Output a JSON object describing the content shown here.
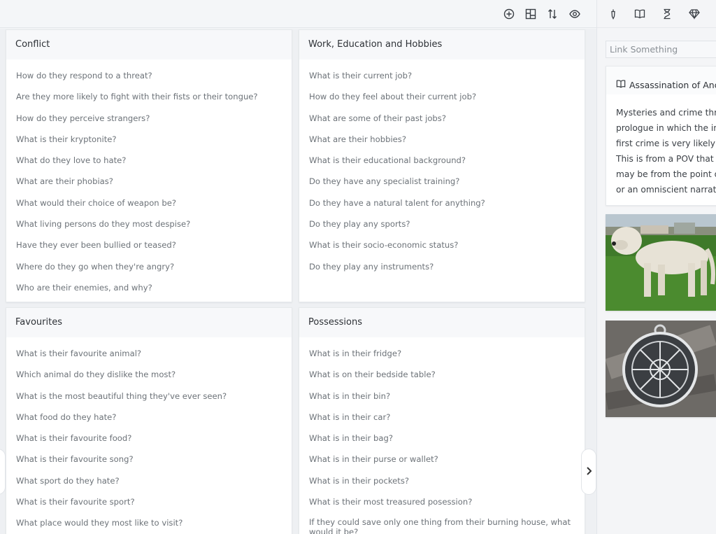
{
  "toolbar": {
    "icons": [
      "add-circle-icon",
      "layout-icon",
      "sort-icon",
      "eye-icon"
    ]
  },
  "right_toolbar": {
    "icons": [
      "pen-icon",
      "book-icon",
      "hourglass-icon",
      "gem-icon"
    ]
  },
  "cards": [
    {
      "title": "Conflict",
      "questions": [
        "How do they respond to a threat?",
        "Are they more likely to fight with their fists or their tongue?",
        "How do they perceive strangers?",
        "What is their kryptonite?",
        "What do they love to hate?",
        "What are their phobias?",
        "What would their choice of weapon be?",
        "What living persons do they most despise?",
        "Have they ever been bullied or teased?",
        "Where do they go when they're angry?",
        "Who are their enemies, and why?"
      ]
    },
    {
      "title": "Work, Education and Hobbies",
      "questions": [
        "What is their current job?",
        "How do they feel about their current job?",
        "What are some of their past jobs?",
        "What are their hobbies?",
        "What is their educational background?",
        "Do they have any specialist training?",
        "Do they have a natural talent for anything?",
        "Do they play any sports?",
        "What is their socio-economic status?",
        "Do they play any instruments?"
      ]
    },
    {
      "title": "Favourites",
      "questions": [
        "What is their favourite animal?",
        "Which animal do they dislike the most?",
        "What is the most beautiful thing they've ever seen?",
        "What food do they hate?",
        "What is their favourite food?",
        "What is their favourite song?",
        "What sport do they hate?",
        "What is their favourite sport?",
        "What place would they most like to visit?"
      ]
    },
    {
      "title": "Possessions",
      "questions": [
        "What is in their fridge?",
        "What is on their bedside table?",
        "What is in their bin?",
        "What is in their car?",
        "What is in their bag?",
        "What is in their purse or wallet?",
        "What is in their pockets?",
        "What is their most treasured posession?",
        "If they could save only one thing from their burning house, what would it be?"
      ]
    }
  ],
  "sidebar": {
    "link_placeholder": "Link Something",
    "document": {
      "title": "Assassination of And",
      "lines": [
        "Mysteries and crime thr",
        "prologue in which the in",
        "first crime is very likely t",
        "This is from a POV that",
        "may be from the point o",
        "or an omniscient narrat"
      ]
    },
    "images": [
      "dog-photo",
      "rune-pendant-photo"
    ]
  },
  "nav": {
    "next_icon": "chevron-right-icon"
  }
}
